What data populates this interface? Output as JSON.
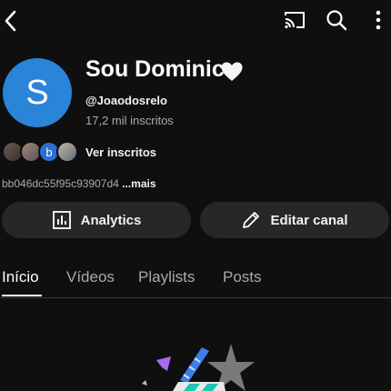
{
  "header": {
    "back_icon": "chevron-left-icon",
    "cast_icon": "cast-icon",
    "search_icon": "search-icon",
    "more_icon": "more-vert-icon"
  },
  "profile": {
    "avatar_letter": "S",
    "avatar_color": "#2a84d8",
    "name": "Sou Dominic",
    "handle": "@Joaodosrelo",
    "subscribers": "17,2 mil inscritos",
    "subscriber_mini_letter": "b",
    "see_subscribers": "Ver inscritos",
    "description": "bb046dc55f95c93907d4",
    "description_more": "...mais"
  },
  "actions": {
    "analytics": "Analytics",
    "edit_channel": "Editar canal"
  },
  "tabs": [
    {
      "label": "Início"
    },
    {
      "label": "Vídeos"
    },
    {
      "label": "Playlists"
    },
    {
      "label": "Posts"
    }
  ],
  "colors": {
    "background": "#0f0f0f",
    "button_bg": "#272727",
    "secondary_text": "#aaaaaa"
  }
}
